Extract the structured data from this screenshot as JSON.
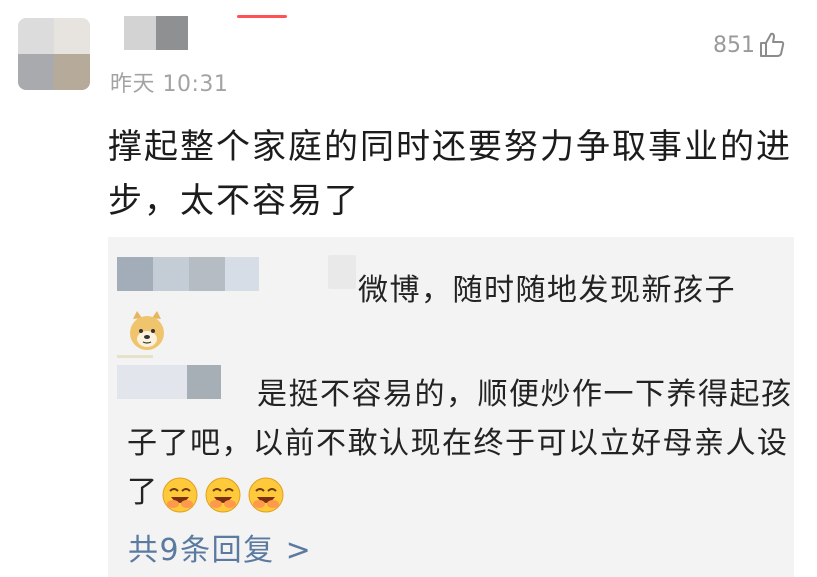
{
  "comment": {
    "timestamp": "昨天 10:31",
    "like_count": "851",
    "text": "撑起整个家庭的同时还要努力争取事业的进步，太不容易了"
  },
  "replies": {
    "reply1_text": "微博，随时随地发现新孩子",
    "reply2_text_line1": "是挺不容易的，顺便炒作一下养",
    "reply2_text_rest": "得起孩子了吧，以前不敢认现在终于可以立好母亲人设了",
    "more_replies_label": "共9条回复 >"
  },
  "icons": {
    "like": "thumbs-up-icon",
    "reply1_emoji": "doge-emoji-icon",
    "reply2_emoji": "laughing-face-emoji-icon"
  },
  "colors": {
    "link": "#5b7aa0",
    "timestamp": "#a3a3a3",
    "reply_background": "#f3f3f3",
    "accent": "#ff5252"
  }
}
